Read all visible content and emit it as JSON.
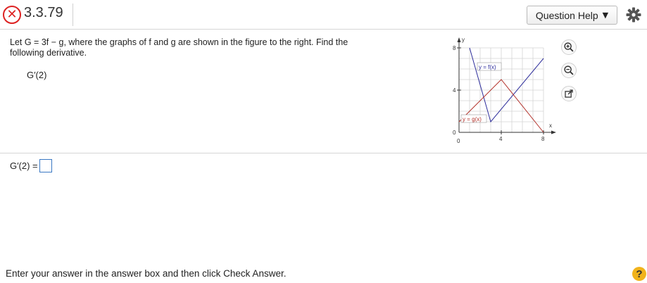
{
  "header": {
    "problem_number": "3.3.79",
    "status_icon": "incorrect-x-icon",
    "status_glyph": "✕",
    "help_label": "Question Help",
    "help_caret": "▼",
    "gear_icon": "gear-icon"
  },
  "question": {
    "line1": "Let G = 3f − g, where the graphs of f and g are shown in the figure to the right. Find the",
    "line2": "following derivative.",
    "expression": "G′(2)"
  },
  "graph": {
    "y_axis_label": "y",
    "x_axis_label": "x",
    "y_ticks": [
      "8",
      "4",
      "0"
    ],
    "x_ticks": [
      "0",
      "4",
      "8"
    ],
    "f_label": "y = f(x)",
    "g_label": "y = g(x)",
    "f_color": "#2b2b9a",
    "g_color": "#b3312a"
  },
  "tools": {
    "zoom_in_icon": "zoom-in-icon",
    "zoom_out_icon": "zoom-out-icon",
    "popout_icon": "popout-icon"
  },
  "answer": {
    "label": "G′(2) ="
  },
  "footer": {
    "instruction": "Enter your answer in the answer box and then click Check Answer.",
    "help_glyph": "?"
  }
}
